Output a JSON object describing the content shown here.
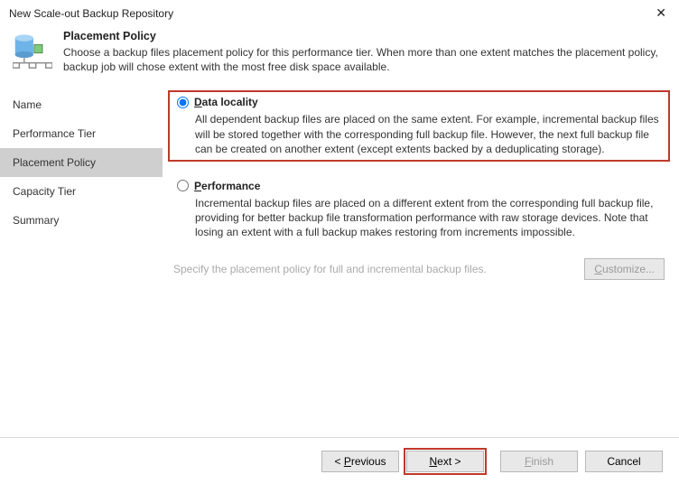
{
  "window": {
    "title": "New Scale-out Backup Repository"
  },
  "header": {
    "title": "Placement Policy",
    "subtitle": "Choose a backup files placement policy for this performance tier. When more than one extent matches the placement policy, backup job will chose extent with the most free disk space available."
  },
  "sidebar": {
    "items": [
      {
        "label": "Name"
      },
      {
        "label": "Performance Tier"
      },
      {
        "label": "Placement Policy"
      },
      {
        "label": "Capacity Tier"
      },
      {
        "label": "Summary"
      }
    ],
    "active_index": 2
  },
  "options": {
    "data_locality": {
      "label_pre": "D",
      "label_rest": "ata locality",
      "desc": "All dependent backup files are placed on the same extent. For example, incremental backup files will be stored together with the corresponding full backup file. However, the next full backup file can be created on another extent (except extents backed by a deduplicating storage).",
      "selected": true
    },
    "performance": {
      "label_pre": "P",
      "label_rest": "erformance",
      "desc": "Incremental backup files are placed on a different extent from the corresponding full backup file, providing for better backup file transformation performance with raw storage devices. Note that losing an extent with a full backup makes restoring from increments impossible.",
      "selected": false
    }
  },
  "spec": {
    "text": "Specify the placement policy for full and incremental backup files.",
    "customize_pre": "C",
    "customize_rest": "ustomize..."
  },
  "footer": {
    "previous_pre": "P",
    "previous_rest": "revious",
    "next_pre": "N",
    "next_rest": "ext >",
    "finish_pre": "F",
    "finish_rest": "inish",
    "cancel": "Cancel"
  }
}
